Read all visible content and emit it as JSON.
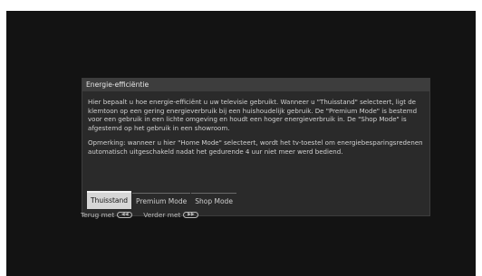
{
  "dialog": {
    "title": "Energie-efficiëntie",
    "description": "Hier bepaalt u hoe energie-efficiënt u uw televisie gebruikt. Wanneer u \"Thuisstand\" selecteert, ligt de klemtoon op een gering energieverbruik bij een huishoudelijk gebruik. De \"Premium Mode\" is bestemd voor een gebruik in een lichte omgeving en houdt een hoger energieverbruik in. De \"Shop Mode\" is afgestemd op het gebruik in een showroom.",
    "remark": "Opmerking: wanneer u hier \"Home Mode\" selecteert, wordt het tv-toestel om energiebesparingsredenen automatisch uitgeschakeld nadat het gedurende 4 uur niet meer werd bediend.",
    "options": [
      {
        "label": "Thuisstand",
        "selected": true
      },
      {
        "label": "Premium Mode",
        "selected": false
      },
      {
        "label": "Shop Mode",
        "selected": false
      }
    ]
  },
  "footer": {
    "back_label": "Terug met",
    "back_icon": "rewind-remote-button-icon",
    "next_label": "Verder met",
    "next_icon": "fast-forward-remote-button-icon"
  }
}
